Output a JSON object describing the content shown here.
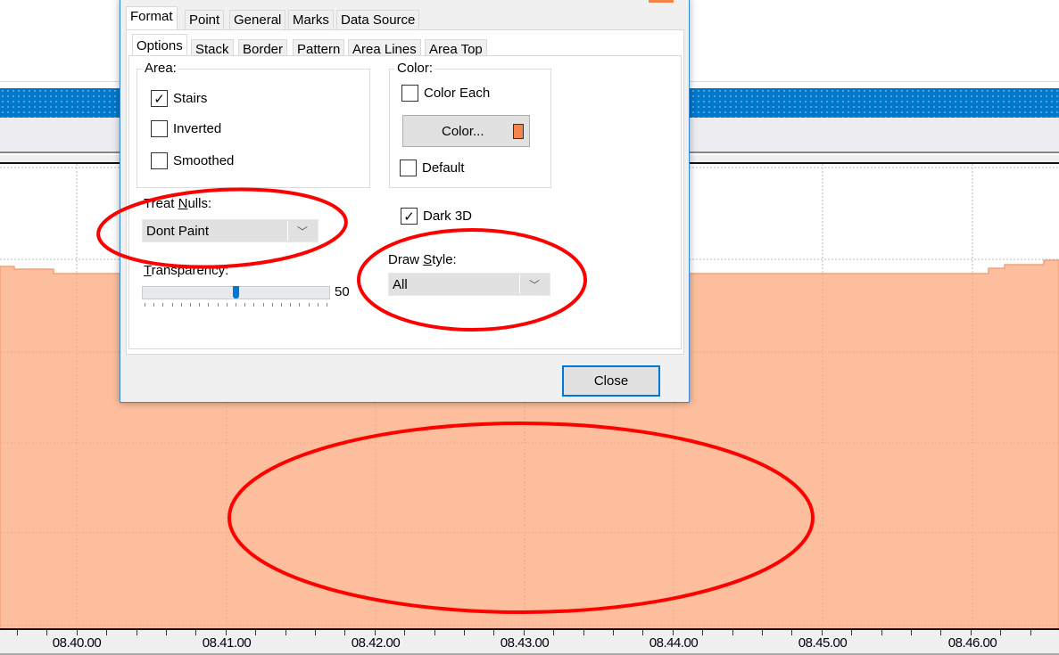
{
  "dialog": {
    "tabs": [
      "Format",
      "Point",
      "General",
      "Marks",
      "Data Source"
    ],
    "subtabs": [
      "Options",
      "Stack",
      "Border",
      "Pattern",
      "Area Lines",
      "Area Top"
    ],
    "area": {
      "label": "Area:",
      "stairs": "Stairs",
      "inverted": "Inverted",
      "smoothed": "Smoothed",
      "stairs_checked": true,
      "inverted_checked": false,
      "smoothed_checked": false
    },
    "color": {
      "label": "Color:",
      "color_each": "Color Each",
      "color_button": "Color...",
      "default": "Default",
      "swatch": "#f4854a"
    },
    "dark3d": "Dark 3D",
    "dark3d_checked": true,
    "treat_nulls": {
      "label": "Treat Nulls:",
      "value": "Dont Paint"
    },
    "draw_style": {
      "label": "Draw Style:",
      "value": "All"
    },
    "transparency": {
      "label": "Transparency:",
      "value": "50",
      "percent": 50
    },
    "close": "Close"
  },
  "chart": {
    "area_color": "#fdbe9d",
    "line_color": "#f4a079",
    "x_labels": [
      "08.40.00",
      "08.41.00",
      "08.42.00",
      "08.43.00",
      "08.44.00",
      "08.45.00",
      "08.46.00"
    ]
  }
}
